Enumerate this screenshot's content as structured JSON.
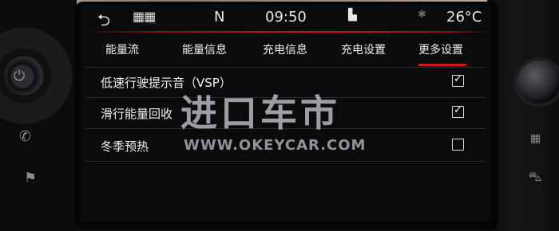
{
  "status": {
    "gear": "N",
    "time": "09:50",
    "temperature": "26°C",
    "icons": [
      "back-arrow-icon",
      "app-grid-icon",
      "user-profile-icon",
      "bluetooth-icon"
    ]
  },
  "tabs": [
    {
      "label": "能量流",
      "active": false
    },
    {
      "label": "能量信息",
      "active": false
    },
    {
      "label": "充电信息",
      "active": false
    },
    {
      "label": "充电设置",
      "active": false
    },
    {
      "label": "更多设置",
      "active": true
    }
  ],
  "settings": [
    {
      "label": "低速行驶提示音（VSP）",
      "checked": true
    },
    {
      "label": "滑行能量回收",
      "checked": true
    },
    {
      "label": "冬季预热",
      "checked": false
    }
  ],
  "watermark": {
    "title": "进口车市",
    "url": "WWW.OKEYCAR.COM"
  },
  "colors": {
    "accent": "#d4181f",
    "screen_bg": "#0a0b0d",
    "text": "#f0f0f2"
  }
}
